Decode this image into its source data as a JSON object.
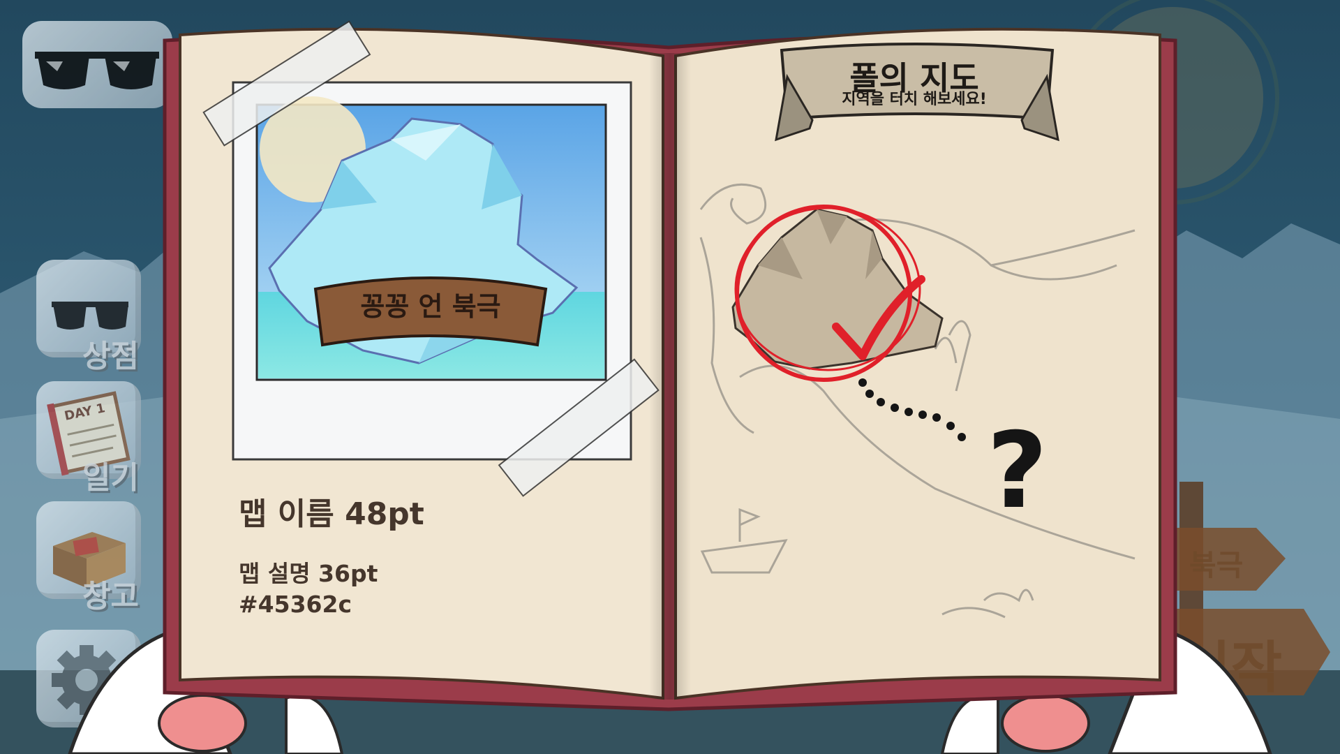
{
  "left_page": {
    "photo_banner": "꽁꽁 언 북극",
    "map_name": "맵 이름 48pt",
    "map_desc_line1": "맵 설명 36pt",
    "map_desc_line2": "#45362c"
  },
  "right_page": {
    "title": "폴의 지도",
    "subtitle": "지역을 터치 해보세요!",
    "unknown_marker": "?"
  },
  "side_menu": {
    "shop_label": "상점",
    "diary_label": "일기",
    "diary_icon_text": "DAY 1",
    "storage_label": "창고"
  },
  "signs": {
    "arctic_label": "북극",
    "start_label": "시작"
  },
  "icons": {
    "sunglasses": "sunglasses-icon",
    "gear": "gear-icon",
    "check": "check-mark-icon"
  },
  "colors": {
    "text_brown": "#45362c",
    "book_cover": "#9b3c4a",
    "page": "#f1e6d2",
    "check_red": "#e0202a"
  }
}
